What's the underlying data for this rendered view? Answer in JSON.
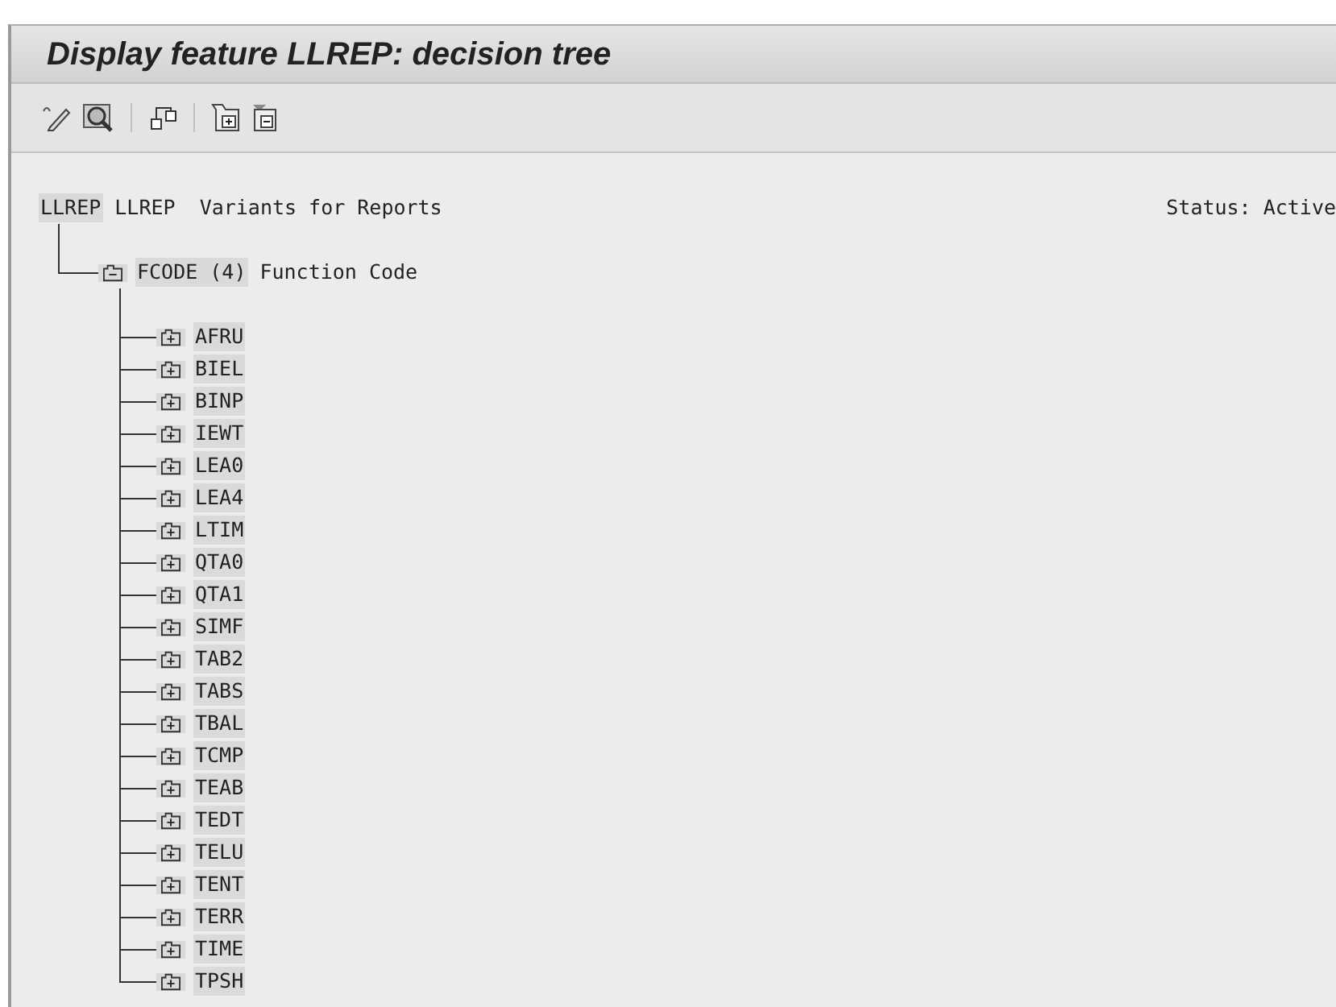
{
  "window": {
    "title": "Display feature LLREP: decision tree"
  },
  "tree": {
    "root": {
      "key": "LLREP",
      "text": "LLREP  Variants for Reports"
    },
    "status": "Status: Active",
    "nodes": [
      {
        "key": "FCODE (4)",
        "text": "Function Code",
        "expanded": true,
        "children": [
          {
            "key": "AFRU",
            "expanded": false
          },
          {
            "key": "BIEL",
            "expanded": false
          },
          {
            "key": "BINP",
            "expanded": false
          },
          {
            "key": "IEWT",
            "expanded": false
          },
          {
            "key": "LEA0",
            "expanded": false
          },
          {
            "key": "LEA4",
            "expanded": false
          },
          {
            "key": "LTIM",
            "expanded": false
          },
          {
            "key": "QTA0",
            "expanded": false
          },
          {
            "key": "QTA1",
            "expanded": false
          },
          {
            "key": "SIMF",
            "expanded": false
          },
          {
            "key": "TAB2",
            "expanded": false
          },
          {
            "key": "TABS",
            "expanded": false
          },
          {
            "key": "TBAL",
            "expanded": false
          },
          {
            "key": "TCMP",
            "expanded": false
          },
          {
            "key": "TEAB",
            "expanded": false
          },
          {
            "key": "TEDT",
            "expanded": false
          },
          {
            "key": "TELU",
            "expanded": false
          },
          {
            "key": "TENT",
            "expanded": false
          },
          {
            "key": "TERR",
            "expanded": false
          },
          {
            "key": "TIME",
            "expanded": false
          },
          {
            "key": "TPSH",
            "expanded": false
          }
        ]
      }
    ]
  }
}
